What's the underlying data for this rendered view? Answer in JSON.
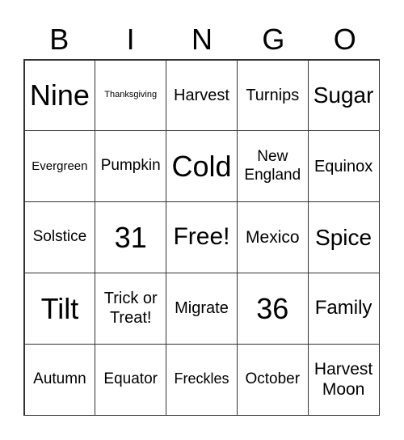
{
  "header": [
    "B",
    "I",
    "N",
    "G",
    "O"
  ],
  "cells": [
    "Nine",
    "Thanksgiving",
    "Harvest",
    "Turnips",
    "Sugar",
    "Evergreen",
    "Pumpkin",
    "Cold",
    "New England",
    "Equinox",
    "Solstice",
    "31",
    "Free!",
    "Mexico",
    "Spice",
    "Tilt",
    "Trick or Treat!",
    "Migrate",
    "36",
    "Family",
    "Autumn",
    "Equator",
    "Freckles",
    "October",
    "Harvest Moon"
  ]
}
